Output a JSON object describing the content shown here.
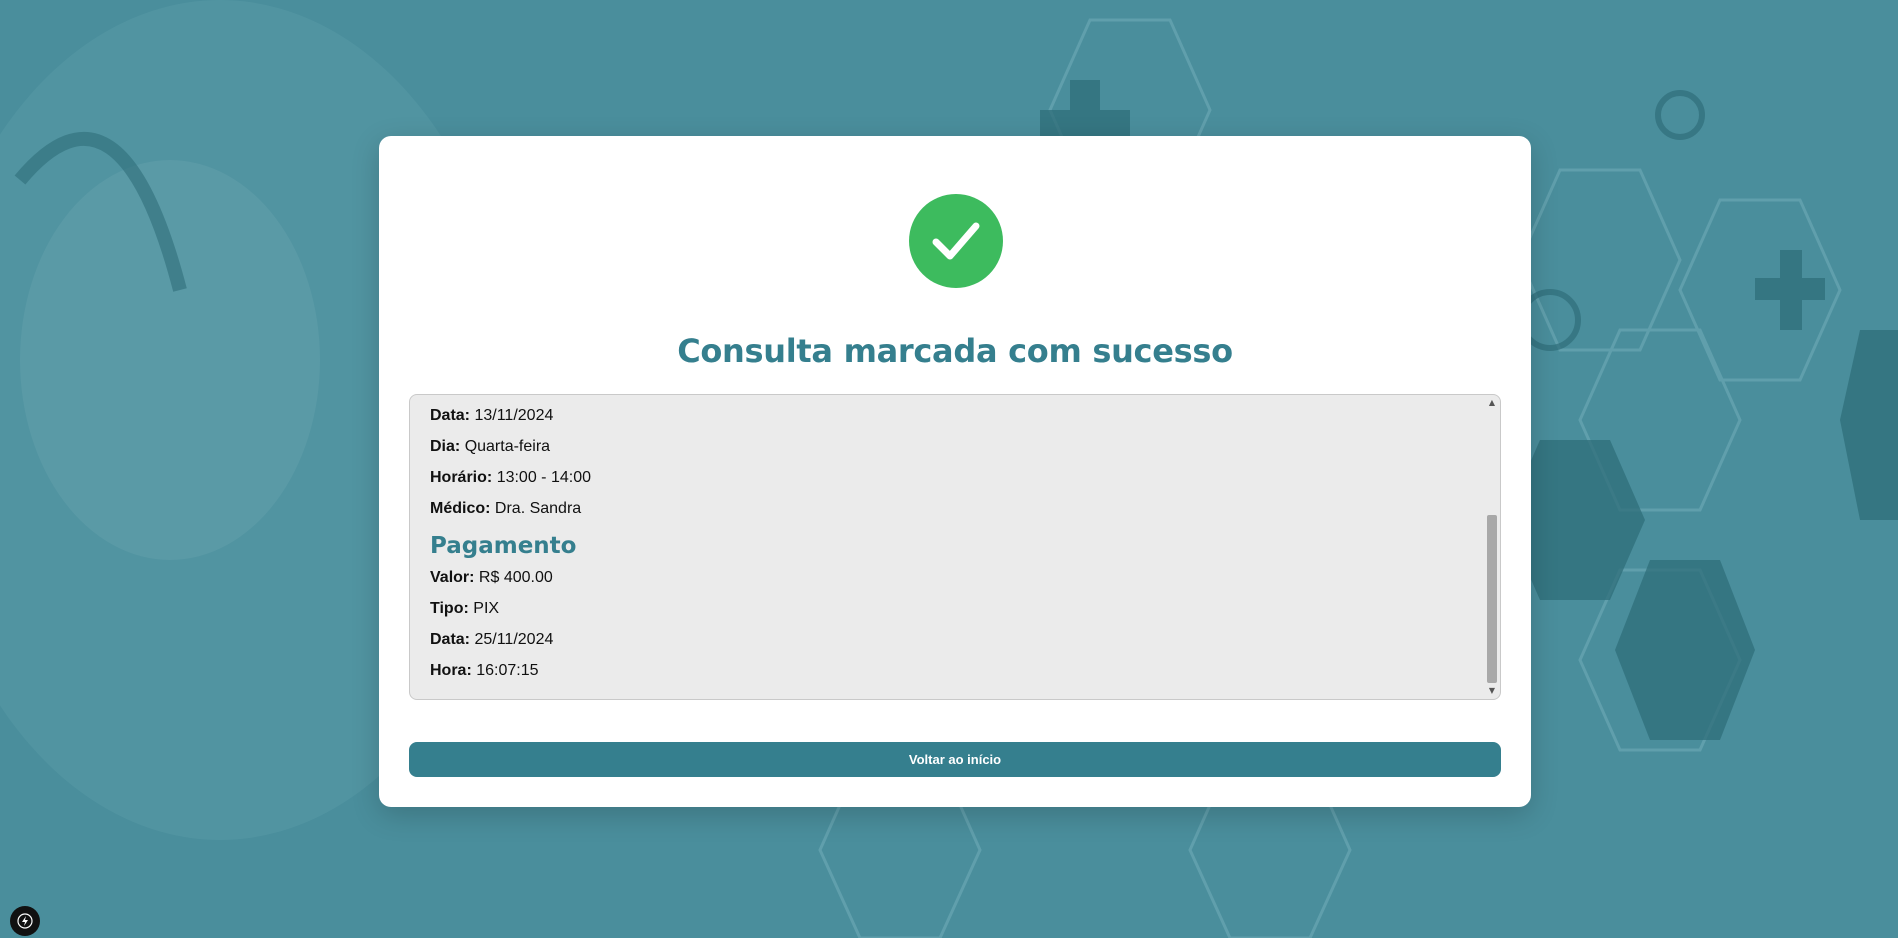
{
  "background": {
    "description_icon": "medical-background-image"
  },
  "modal": {
    "icon": "check-circle-icon",
    "title": "Consulta marcada com sucesso",
    "details": [
      {
        "label": "Data:",
        "value": "13/11/2024"
      },
      {
        "label": "Dia:",
        "value": "Quarta-feira"
      },
      {
        "label": "Horário:",
        "value": "13:00 - 14:00"
      },
      {
        "label": "Médico:",
        "value": "Dra. Sandra"
      }
    ],
    "payment": {
      "heading": "Pagamento",
      "rows": [
        {
          "label": "Valor:",
          "value": "R$ 400.00"
        },
        {
          "label": "Tipo:",
          "value": "PIX"
        },
        {
          "label": "Data:",
          "value": "25/11/2024"
        },
        {
          "label": "Hora:",
          "value": "16:07:15"
        }
      ]
    },
    "scroll_position": 0.6,
    "back_button_label": "Voltar ao início"
  },
  "colors": {
    "accent": "#357f8e",
    "success": "#3dbb5e",
    "background": "#4a8e9c"
  },
  "corner_badge_icon": "lightning-icon"
}
